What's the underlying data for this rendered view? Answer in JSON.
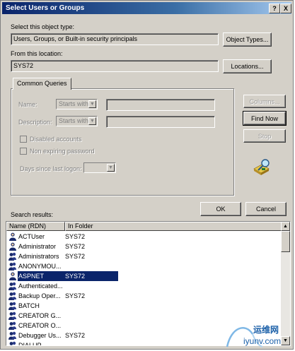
{
  "window": {
    "title": "Select Users or Groups",
    "help_button": "?",
    "close_button": "X"
  },
  "object_type": {
    "label": "Select this object type:",
    "value": "Users, Groups, or Built-in security principals",
    "button": "Object Types..."
  },
  "location": {
    "label": "From this location:",
    "value": "SYS72",
    "button": "Locations..."
  },
  "common_queries": {
    "tab_label": "Common Queries",
    "name_label": "Name:",
    "name_mode": "Starts with",
    "description_label": "Description:",
    "description_mode": "Starts with",
    "disabled_accounts": "Disabled accounts",
    "non_expiring_password": "Non expiring password",
    "days_since_logon": "Days since last logon:"
  },
  "side_buttons": {
    "columns": "Columns...",
    "find_now": "Find Now",
    "stop": "Stop"
  },
  "search_icon": "search-magnifier-icon",
  "ok_button": "OK",
  "cancel_button": "Cancel",
  "results": {
    "label": "Search results:",
    "columns": [
      "Name (RDN)",
      "In Folder"
    ],
    "rows": [
      {
        "name": "ACTUser",
        "folder": "SYS72",
        "icon": "user-icon",
        "selected": false
      },
      {
        "name": "Administrator",
        "folder": "SYS72",
        "icon": "user-icon",
        "selected": false
      },
      {
        "name": "Administrators",
        "folder": "SYS72",
        "icon": "group-icon",
        "selected": false
      },
      {
        "name": "ANONYMOU...",
        "folder": "",
        "icon": "group-icon",
        "selected": false
      },
      {
        "name": "ASPNET",
        "folder": "SYS72",
        "icon": "user-icon",
        "selected": true
      },
      {
        "name": "Authenticated...",
        "folder": "",
        "icon": "group-icon",
        "selected": false
      },
      {
        "name": "Backup Oper...",
        "folder": "SYS72",
        "icon": "group-icon",
        "selected": false
      },
      {
        "name": "BATCH",
        "folder": "",
        "icon": "group-icon",
        "selected": false
      },
      {
        "name": "CREATOR G...",
        "folder": "",
        "icon": "group-icon",
        "selected": false
      },
      {
        "name": "CREATOR O...",
        "folder": "",
        "icon": "group-icon",
        "selected": false
      },
      {
        "name": "Debugger Us...",
        "folder": "SYS72",
        "icon": "group-icon",
        "selected": false
      },
      {
        "name": "DIALUP",
        "folder": "",
        "icon": "group-icon",
        "selected": false
      }
    ]
  },
  "watermark": {
    "text": "运维网",
    "url": "iyunv.com"
  },
  "colors": {
    "face": "#d4d0c8",
    "title_start": "#0a246a",
    "title_end": "#a6caf0",
    "selection": "#0a246a"
  }
}
